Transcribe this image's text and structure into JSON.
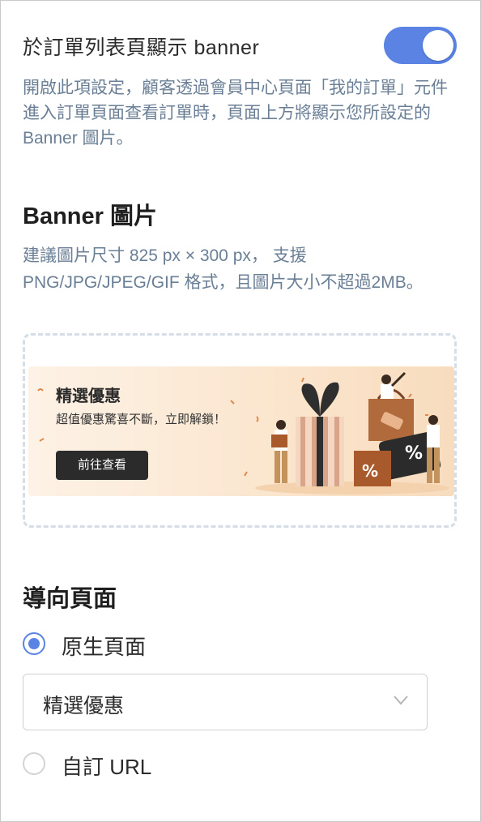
{
  "toggle_section": {
    "label": "於訂單列表頁顯示 banner",
    "enabled": true,
    "description": "開啟此項設定，顧客透過會員中心頁面「我的訂單」元件進入訂單頁面查看訂單時，頁面上方將顯示您所設定的 Banner 圖片。"
  },
  "banner_section": {
    "title": "Banner 圖片",
    "hint": "建議圖片尺寸 825 px × 300 px， 支援PNG/JPG/JPEG/GIF 格式，且圖片大小不超過2MB。",
    "preview": {
      "title": "精選優惠",
      "subtitle": "超值優惠驚喜不斷，立即解鎖！",
      "button": "前往查看"
    }
  },
  "redirect_section": {
    "title": "導向頁面",
    "options": [
      {
        "label": "原生頁面",
        "checked": true
      },
      {
        "label": "自訂 URL",
        "checked": false
      }
    ],
    "selected_page": "精選優惠"
  },
  "colors": {
    "accent": "#5b83e4",
    "description_text": "#6a7f96",
    "dashed_border": "#d5dde6"
  }
}
